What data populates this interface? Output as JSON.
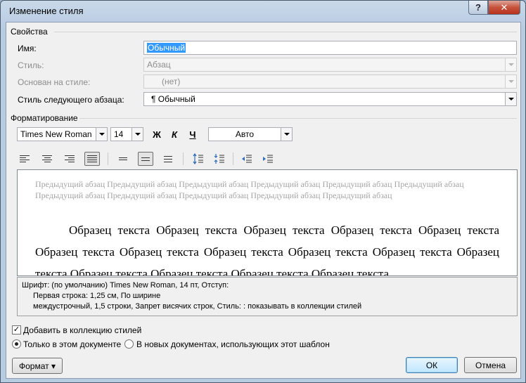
{
  "window": {
    "title": "Изменение стиля",
    "help": "?",
    "close": "✕"
  },
  "properties": {
    "heading": "Свойства",
    "name_label": "Имя:",
    "name_value": "Обычный",
    "style_label": "Стиль:",
    "style_value": "Абзац",
    "based_label": "Основан на стиле:",
    "based_value": "(нет)",
    "next_label": "Стиль следующего абзаца:",
    "next_value": "¶  Обычный"
  },
  "formatting": {
    "heading": "Форматирование",
    "font": "Times New Roman",
    "size": "14",
    "bold": "Ж",
    "italic": "К",
    "underline": "Ч",
    "color": "Авто"
  },
  "preview": {
    "previous": "Предыдущий абзац Предыдущий абзац Предыдущий абзац Предыдущий абзац Предыдущий абзац Предыдущий абзац Предыдущий абзац Предыдущий абзац Предыдущий абзац Предыдущий абзац Предыдущий абзац",
    "sample": "Образец текста Образец текста Образец текста Образец текста Образец текста Образец текста Образец текста Образец текста Образец текста Образец текста Образец текста Образец текста Образец текста Образец текста Образец текста"
  },
  "description": {
    "line1": "Шрифт: (по умолчанию) Times New Roman, 14 пт, Отступ:",
    "line2": "Первая строка:  1,25 см, По ширине",
    "line3": "междустрочный,  1,5 строки, Запрет висячих строк, Стиль: : показывать в коллекции стилей"
  },
  "options": {
    "add_to_gallery": "Добавить в коллекцию стилей",
    "only_this_doc": "Только в этом документе",
    "new_docs": "В новых документах, использующих этот шаблон"
  },
  "buttons": {
    "format": "Формат ▾",
    "ok": "ОК",
    "cancel": "Отмена"
  }
}
